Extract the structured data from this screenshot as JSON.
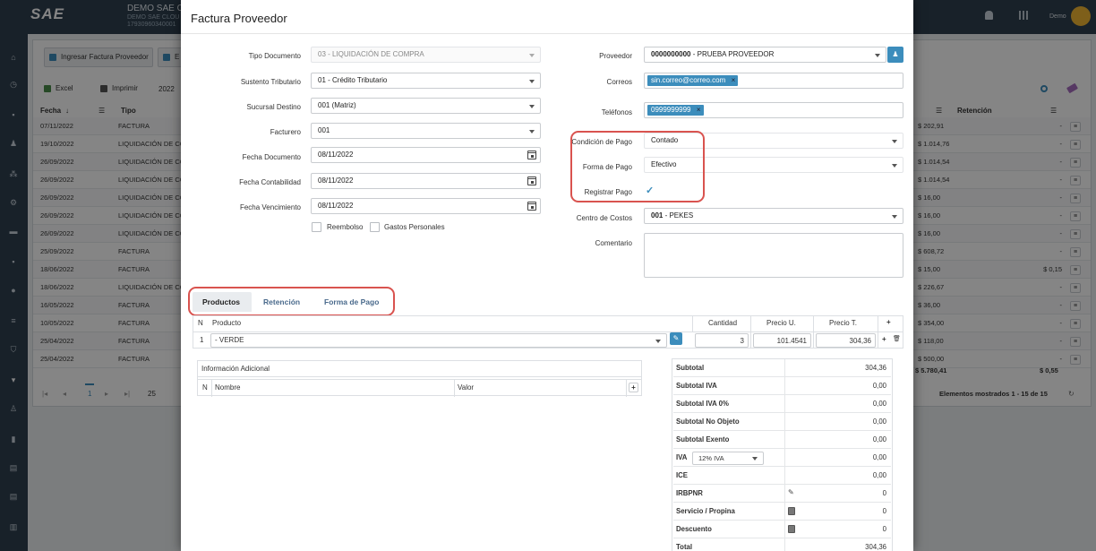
{
  "background": {
    "brand_logo": "SAE",
    "company_name": "DEMO SAE CL",
    "company_sub1": "DEMO SAE CLOU",
    "company_sub2": "17930960340001",
    "user_name": "Demo",
    "buttons": {
      "ingresar": "Ingresar Factura Proveedor",
      "e": "E",
      "excel": "Excel",
      "imprimir": "Imprimir",
      "year": "2022"
    },
    "columns": {
      "fecha": "Fecha",
      "tipo": "Tipo",
      "retencion": "Retención"
    },
    "rows": [
      {
        "fecha": "07/11/2022",
        "tipo": "FACTURA",
        "total": "$ 202,91",
        "ret": "-"
      },
      {
        "fecha": "19/10/2022",
        "tipo": "LIQUIDACIÓN DE CO",
        "total": "$ 1.014,76",
        "ret": "-"
      },
      {
        "fecha": "26/09/2022",
        "tipo": "LIQUIDACIÓN DE CO",
        "total": "$ 1.014,54",
        "ret": "-"
      },
      {
        "fecha": "26/09/2022",
        "tipo": "LIQUIDACIÓN DE CO",
        "total": "$ 1.014,54",
        "ret": "-"
      },
      {
        "fecha": "26/09/2022",
        "tipo": "LIQUIDACIÓN DE CO",
        "total": "$ 16,00",
        "ret": "-"
      },
      {
        "fecha": "26/09/2022",
        "tipo": "LIQUIDACIÓN DE CO",
        "total": "$ 16,00",
        "ret": "-"
      },
      {
        "fecha": "26/09/2022",
        "tipo": "LIQUIDACIÓN DE CO",
        "total": "$ 16,00",
        "ret": "-"
      },
      {
        "fecha": "25/09/2022",
        "tipo": "FACTURA",
        "total": "$ 608,72",
        "ret": "-"
      },
      {
        "fecha": "18/06/2022",
        "tipo": "FACTURA",
        "total": "$ 15,00",
        "ret": "$ 0,15"
      },
      {
        "fecha": "18/06/2022",
        "tipo": "LIQUIDACIÓN DE CO",
        "total": "$ 226,67",
        "ret": "-"
      },
      {
        "fecha": "16/05/2022",
        "tipo": "FACTURA",
        "total": "$ 36,00",
        "ret": "-"
      },
      {
        "fecha": "10/05/2022",
        "tipo": "FACTURA",
        "total": "$ 354,00",
        "ret": "-"
      },
      {
        "fecha": "25/04/2022",
        "tipo": "FACTURA",
        "total": "$ 118,00",
        "ret": "-"
      },
      {
        "fecha": "25/04/2022",
        "tipo": "FACTURA",
        "total": "$ 500,00",
        "ret": "-"
      }
    ],
    "sum_total": "$ 5.780,41",
    "sum_ret": "$ 0,55",
    "pager_page": "1",
    "page_size": "25",
    "shown": "Elementos mostrados 1 - 15 de 15"
  },
  "modal": {
    "title": "Factura Proveedor",
    "left": {
      "tipo_documento": {
        "label": "Tipo Documento",
        "value": "03 - LIQUIDACIÓN DE COMPRA"
      },
      "sustento": {
        "label": "Sustento Tributario",
        "value": "01 - Crédito Tributario"
      },
      "sucursal": {
        "label": "Sucursal Destino",
        "value": "001 (Matriz)"
      },
      "facturero": {
        "label": "Facturero",
        "value": "001"
      },
      "fecha_doc": {
        "label": "Fecha Documento",
        "value": "08/11/2022"
      },
      "fecha_cont": {
        "label": "Fecha Contabilidad",
        "value": "08/11/2022"
      },
      "fecha_venc": {
        "label": "Fecha Vencimiento",
        "value": "08/11/2022"
      },
      "reembolso": "Reembolso",
      "gastos": "Gastos Personales"
    },
    "right": {
      "proveedor": {
        "label": "Proveedor",
        "code": "0000000000",
        "name": " - PRUEBA PROVEEDOR"
      },
      "correos": {
        "label": "Correos",
        "tag": "sin.correo@correo.com"
      },
      "telefonos": {
        "label": "Teléfonos",
        "tag": "0999999999"
      },
      "condicion": {
        "label": "Condición de Pago",
        "value": "Contado"
      },
      "forma": {
        "label": "Forma de Pago",
        "value": "Efectivo"
      },
      "registrar": {
        "label": "Registrar Pago"
      },
      "centro": {
        "label": "Centro de Costos",
        "code": "001",
        "name": " - PEKES"
      },
      "comentario": {
        "label": "Comentario"
      }
    },
    "tabs": [
      "Productos",
      "Retención",
      "Forma de Pago"
    ],
    "products": {
      "headers": {
        "n": "N",
        "producto": "Producto",
        "cantidad": "Cantidad",
        "precio_u": "Precio U.",
        "precio_t": "Precio T."
      },
      "row": {
        "n": "1",
        "producto": " - VERDE",
        "cantidad": "3",
        "precio_u": "101.4541",
        "precio_t": "304,36"
      }
    },
    "info_adicional": {
      "title": "Información Adicional",
      "n": "N",
      "nombre": "Nombre",
      "valor": "Valor"
    },
    "totals": [
      {
        "label": "Subtotal",
        "value": "304,36"
      },
      {
        "label": "Subtotal IVA",
        "value": "0,00"
      },
      {
        "label": "Subtotal IVA 0%",
        "value": "0,00"
      },
      {
        "label": "Subtotal No Objeto",
        "value": "0,00"
      },
      {
        "label": "Subtotal Exento",
        "value": "0,00"
      },
      {
        "label": "IVA",
        "value": "0,00",
        "select": "12% IVA"
      },
      {
        "label": "ICE",
        "value": "0,00"
      },
      {
        "label": "IRBPNR",
        "value": "0"
      },
      {
        "label": "Servicio / Propina",
        "value": "0"
      },
      {
        "label": "Descuento",
        "value": "0"
      },
      {
        "label": "Total",
        "value": "304,36"
      }
    ],
    "colors": {
      "accent": "#3c8dbc",
      "highlight": "#d9534f"
    }
  }
}
